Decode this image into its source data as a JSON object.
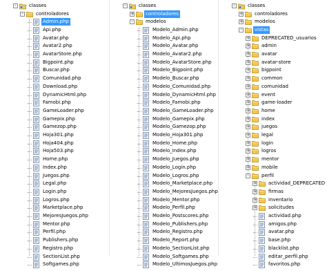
{
  "col1": {
    "root": "classes",
    "folder": "controladores",
    "selected_index": 0,
    "files": [
      "Admin.php",
      "Api.php",
      "Avatar.php",
      "Avatar2.php",
      "AvatarStore.php",
      "Bigpoint.php",
      "Buscar.php",
      "Comunidad.php",
      "Download.php",
      "DynamicHtml.php",
      "Famobi.php",
      "GameLoader.php",
      "Gamepix.php",
      "Gamezop.php",
      "Hoja301.php",
      "Hoja404.php",
      "Hoja503.php",
      "Home.php",
      "Index.php",
      "Juegos.php",
      "Legal.php",
      "Login.php",
      "Logros.php",
      "Marketplace.php",
      "MejoresJuegos.php",
      "Mentor.php",
      "Perfil.php",
      "Publishers.php",
      "Registro.php",
      "SectionList.php",
      "Softgames.php"
    ]
  },
  "col2": {
    "root": "classes",
    "folder_selected": "controladores",
    "folder": "modelos",
    "files": [
      "Modelo_Admin.php",
      "Modelo_Api.php",
      "Modelo_Avatar.php",
      "Modelo_Avatar2.php",
      "Modelo_AvatarStore.php",
      "Modelo_Bigpoint.php",
      "Modelo_Buscar.php",
      "Modelo_Comunidad.php",
      "Modelo_DynamicHtml.php",
      "Modelo_Famobi.php",
      "Modelo_GameLoader.php",
      "Modelo_Gamepix.php",
      "Modelo_Gamezop.php",
      "Modelo_Hoja301.php",
      "Modelo_Home.php",
      "Modelo_Index.php",
      "Modelo_Juegos.php",
      "Modelo_Login.php",
      "Modelo_Logros.php",
      "Modelo_Marketplace.php",
      "Modelo_MejoresJuegos.php",
      "Modelo_Mentor.php",
      "Modelo_Perfil.php",
      "Modelo_Postscores.php",
      "Modelo_Publishers.php",
      "Modelo_Registro.php",
      "Modelo_Report.php",
      "Modelo_SectionList.php",
      "Modelo_Softgames.php",
      "Modelo_UltimosJuegos.php"
    ]
  },
  "col3": {
    "root": "classes",
    "folder1": "controladores",
    "folder2": "modelos",
    "vistas": "vistas",
    "vistas_children": [
      "DEPRECATED_usuarios",
      "admin",
      "avatar",
      "avatar-store",
      "bigpoint",
      "common",
      "comunidad",
      "event",
      "game-loader",
      "home",
      "index",
      "juegos",
      "legal",
      "login",
      "logros",
      "mentor",
      "mobile",
      "perfil"
    ],
    "perfil_folders": [
      "actividad_DEPRECATED",
      "firmas",
      "inventario",
      "solicitudes"
    ],
    "perfil_files": [
      "actividad.php",
      "amigos.php",
      "avatar.php",
      "base.php",
      "blacklist.php",
      "editar_perfil.php",
      "favoritos.php"
    ]
  }
}
